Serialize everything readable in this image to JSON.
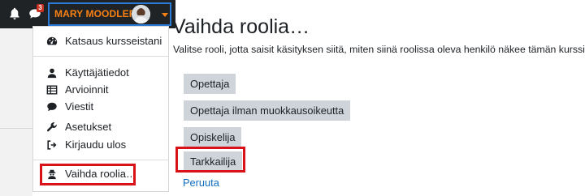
{
  "navbar": {
    "notification_count": "3",
    "user_name": "MARY MOODLER",
    "icons": [
      "bell-icon",
      "chat-icon",
      "avatar",
      "caret-down-icon"
    ]
  },
  "menu": {
    "items": [
      {
        "label": "Katsaus kursseistani",
        "icon": "dashboard-icon"
      },
      {
        "label": "Käyttäjätiedot",
        "icon": "user-icon"
      },
      {
        "label": "Arvioinnit",
        "icon": "table-icon"
      },
      {
        "label": "Viestit",
        "icon": "comment-icon"
      },
      {
        "label": "Asetukset",
        "icon": "wrench-icon"
      },
      {
        "label": "Kirjaudu ulos",
        "icon": "sign-out-icon"
      },
      {
        "label": "Vaihda roolia…",
        "icon": "user-secret-icon"
      }
    ]
  },
  "main": {
    "title": "Vaihda roolia…",
    "description": "Valitse rooli, jotta saisit käsityksen siitä, miten siinä roolissa oleva henkilö näkee tämän kurssin.",
    "roles": [
      "Opettaja",
      "Opettaja ilman muokkausoikeutta",
      "Opiskelija",
      "Tarkkailija"
    ],
    "cancel": "Peruuta"
  },
  "colors": {
    "navbar_bg": "#1f2326",
    "user_name": "#f98012",
    "highlight": "#d9121a",
    "link": "#0f6cbf",
    "button_bg": "#ced4da"
  }
}
